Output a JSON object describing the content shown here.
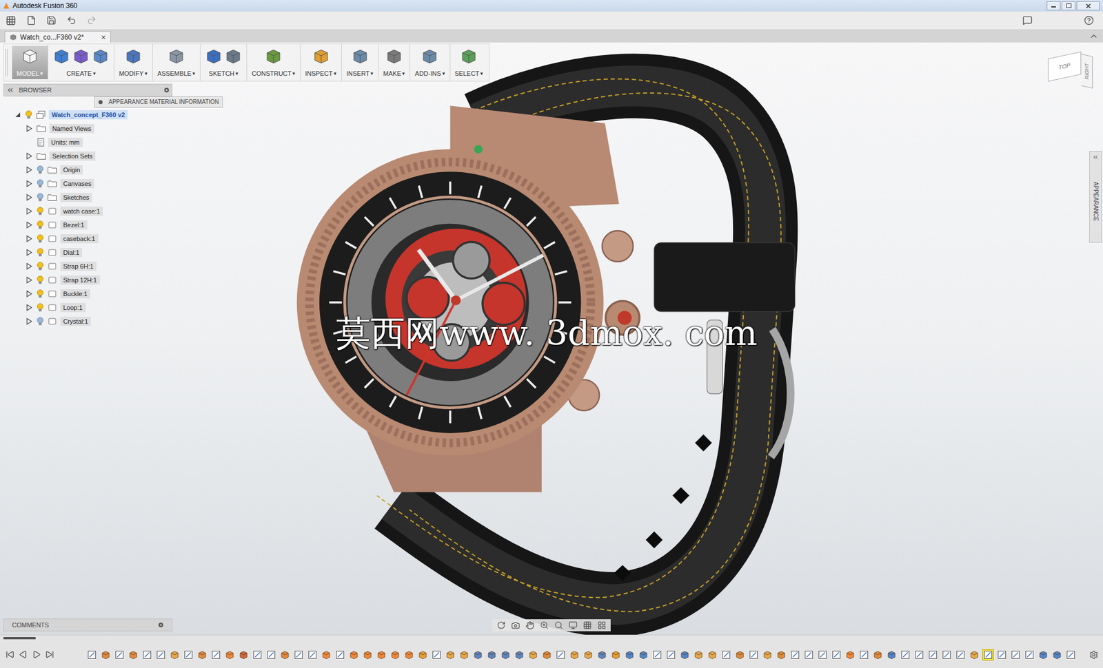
{
  "window": {
    "title": "Autodesk Fusion 360"
  },
  "document_tab": {
    "label": "Watch_co...F360 v2*",
    "close": "×",
    "selected": true
  },
  "toolbar": {
    "caret": "▾",
    "groups": [
      {
        "label": "MODEL",
        "selected": true
      },
      {
        "label": "CREATE",
        "selected": false
      },
      {
        "label": "MODIFY",
        "selected": false
      },
      {
        "label": "ASSEMBLE",
        "selected": false
      },
      {
        "label": "SKETCH",
        "selected": false
      },
      {
        "label": "CONSTRUCT",
        "selected": false
      },
      {
        "label": "INSPECT",
        "selected": false
      },
      {
        "label": "INSERT",
        "selected": false
      },
      {
        "label": "MAKE",
        "selected": false
      },
      {
        "label": "ADD-INS",
        "selected": false
      },
      {
        "label": "SELECT",
        "selected": false
      }
    ]
  },
  "browser": {
    "title": "BROWSER",
    "tooltip": "APPEARANCE MATERIAL INFORMATION",
    "items": [
      {
        "label": "Watch_concept_F360 v2",
        "kind": "root",
        "depth": 0,
        "expandable": true,
        "expanded": true,
        "visible": true,
        "selected": true
      },
      {
        "label": "Named Views",
        "kind": "folder",
        "depth": 1,
        "expandable": true,
        "expanded": false,
        "selected": false
      },
      {
        "label": "Units: mm",
        "kind": "units",
        "depth": 1,
        "expandable": false,
        "expanded": false,
        "selected": false
      },
      {
        "label": "Selection Sets",
        "kind": "folder",
        "depth": 1,
        "expandable": true,
        "expanded": false,
        "selected": false
      },
      {
        "label": "Origin",
        "kind": "bulb-folder",
        "depth": 1,
        "expandable": true,
        "expanded": false,
        "visible": false,
        "selected": false
      },
      {
        "label": "Canvases",
        "kind": "bulb-folder",
        "depth": 1,
        "expandable": true,
        "expanded": false,
        "visible": false,
        "selected": false
      },
      {
        "label": "Sketches",
        "kind": "bulb-folder",
        "depth": 1,
        "expandable": true,
        "expanded": false,
        "visible": false,
        "selected": false
      },
      {
        "label": "watch case:1",
        "kind": "component",
        "depth": 1,
        "expandable": true,
        "expanded": false,
        "visible": true,
        "selected": false
      },
      {
        "label": "Bezel:1",
        "kind": "component",
        "depth": 1,
        "expandable": true,
        "expanded": false,
        "visible": true,
        "selected": false
      },
      {
        "label": "caseback:1",
        "kind": "component",
        "depth": 1,
        "expandable": true,
        "expanded": false,
        "visible": true,
        "selected": false
      },
      {
        "label": "Dial:1",
        "kind": "component",
        "depth": 1,
        "expandable": true,
        "expanded": false,
        "visible": true,
        "selected": false
      },
      {
        "label": "Strap 6H:1",
        "kind": "component",
        "depth": 1,
        "expandable": true,
        "expanded": false,
        "visible": true,
        "selected": false
      },
      {
        "label": "Strap 12H:1",
        "kind": "component",
        "depth": 1,
        "expandable": true,
        "expanded": false,
        "visible": true,
        "selected": false
      },
      {
        "label": "Buckle:1",
        "kind": "component",
        "depth": 1,
        "expandable": true,
        "expanded": false,
        "visible": true,
        "selected": false
      },
      {
        "label": "Loop:1",
        "kind": "component",
        "depth": 1,
        "expandable": true,
        "expanded": false,
        "visible": true,
        "selected": false
      },
      {
        "label": "Crystal:1",
        "kind": "component",
        "depth": 1,
        "expandable": true,
        "expanded": false,
        "visible": false,
        "selected": false
      }
    ]
  },
  "comments": {
    "title": "COMMENTS"
  },
  "view_cube": {
    "top": "TOP",
    "right": "RIGHT"
  },
  "side_panel": {
    "label": "APPEARANCE"
  },
  "watermark": "莫西网www. 3dmox. com",
  "timeline": {
    "features": [
      {
        "kind": "sketch",
        "selected": false
      },
      {
        "kind": "body",
        "selected": false
      },
      {
        "kind": "sketch",
        "selected": false
      },
      {
        "kind": "body",
        "selected": false
      },
      {
        "kind": "sketch",
        "selected": false
      },
      {
        "kind": "sketch",
        "selected": false
      },
      {
        "kind": "revolve",
        "selected": false
      },
      {
        "kind": "sketch",
        "selected": false
      },
      {
        "kind": "body",
        "selected": false
      },
      {
        "kind": "sketch",
        "selected": false
      },
      {
        "kind": "fillet",
        "selected": false
      },
      {
        "kind": "combine",
        "selected": false
      },
      {
        "kind": "sketch",
        "selected": false
      },
      {
        "kind": "sketch",
        "selected": false
      },
      {
        "kind": "body",
        "selected": false
      },
      {
        "kind": "sketch",
        "selected": false
      },
      {
        "kind": "sketch",
        "selected": false
      },
      {
        "kind": "fillet",
        "selected": false
      },
      {
        "kind": "sketch",
        "selected": false
      },
      {
        "kind": "fillet",
        "selected": false
      },
      {
        "kind": "fillet",
        "selected": false
      },
      {
        "kind": "fillet",
        "selected": false
      },
      {
        "kind": "fillet",
        "selected": false
      },
      {
        "kind": "fillet",
        "selected": false
      },
      {
        "kind": "plane",
        "selected": false
      },
      {
        "kind": "sketch",
        "selected": false
      },
      {
        "kind": "revolve",
        "selected": false
      },
      {
        "kind": "revolve",
        "selected": false
      },
      {
        "kind": "mirror",
        "selected": false
      },
      {
        "kind": "pattern",
        "selected": false
      },
      {
        "kind": "pattern",
        "selected": false
      },
      {
        "kind": "pattern",
        "selected": false
      },
      {
        "kind": "revolve",
        "selected": false
      },
      {
        "kind": "body",
        "selected": false
      },
      {
        "kind": "sketch",
        "selected": false
      },
      {
        "kind": "revolve",
        "selected": false
      },
      {
        "kind": "revolve",
        "selected": false
      },
      {
        "kind": "pattern",
        "selected": false
      },
      {
        "kind": "plane",
        "selected": false
      },
      {
        "kind": "move",
        "selected": false
      },
      {
        "kind": "move",
        "selected": false
      },
      {
        "kind": "sketch",
        "selected": false
      },
      {
        "kind": "sketch",
        "selected": false
      },
      {
        "kind": "move",
        "selected": false
      },
      {
        "kind": "revolve",
        "selected": false
      },
      {
        "kind": "revolve",
        "selected": false
      },
      {
        "kind": "sketch",
        "selected": false
      },
      {
        "kind": "body",
        "selected": false
      },
      {
        "kind": "sketch",
        "selected": false
      },
      {
        "kind": "revolve",
        "selected": false
      },
      {
        "kind": "body",
        "selected": false
      },
      {
        "kind": "sketch",
        "selected": false
      },
      {
        "kind": "sketch",
        "selected": false
      },
      {
        "kind": "sketch",
        "selected": false
      },
      {
        "kind": "sketch",
        "selected": false
      },
      {
        "kind": "fillet",
        "selected": false
      },
      {
        "kind": "sketch",
        "selected": false
      },
      {
        "kind": "body",
        "selected": false
      },
      {
        "kind": "move",
        "selected": false
      },
      {
        "kind": "sketch",
        "selected": false
      },
      {
        "kind": "sketch",
        "selected": false
      },
      {
        "kind": "sketch",
        "selected": false
      },
      {
        "kind": "sketch",
        "selected": false
      },
      {
        "kind": "sketch",
        "selected": false
      },
      {
        "kind": "revolve",
        "selected": false
      },
      {
        "kind": "sketch",
        "selected": true
      },
      {
        "kind": "sketch",
        "selected": false
      },
      {
        "kind": "sketch",
        "selected": false
      },
      {
        "kind": "sketch",
        "selected": false
      },
      {
        "kind": "move",
        "selected": false
      },
      {
        "kind": "move",
        "selected": false
      },
      {
        "kind": "sketch",
        "selected": false
      }
    ]
  }
}
